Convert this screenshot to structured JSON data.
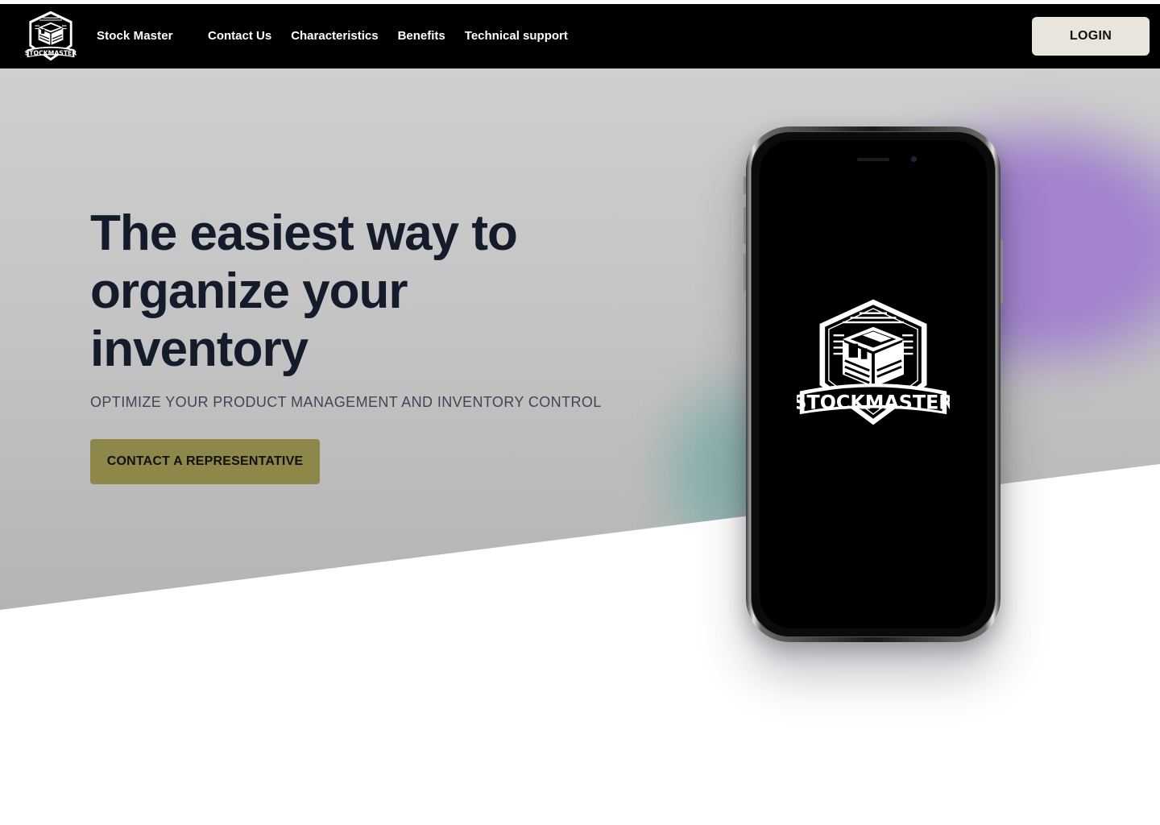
{
  "navbar": {
    "brand": "Stock Master",
    "logo_icon": "stockmaster-logo-icon",
    "logo_text": "STOCKMASTER",
    "links": [
      "Contact Us",
      "Characteristics",
      "Benefits",
      "Technical support"
    ],
    "login_label": "LOGIN"
  },
  "hero": {
    "title": "The easiest way to organize your inventory",
    "subtitle": "OPTIMIZE YOUR PRODUCT MANAGEMENT AND INVENTORY CONTROL",
    "cta_label": "CONTACT A REPRESENTATIVE"
  },
  "phone": {
    "screen_logo_icon": "stockmaster-logo-icon",
    "screen_logo_text": "STOCKMASTER"
  },
  "colors": {
    "navbar_bg": "#000000",
    "login_bg": "#e8e6dc",
    "cta_bg": "#8d874a",
    "title_color": "#141b2b",
    "accent_purple": "#a080cd",
    "accent_teal": "#82afaa"
  }
}
